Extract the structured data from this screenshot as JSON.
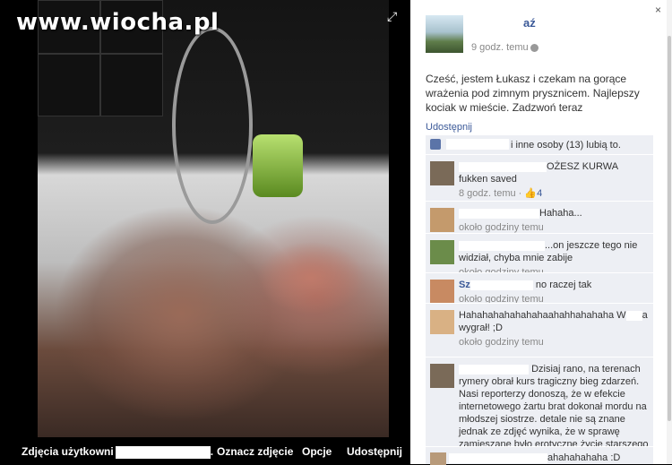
{
  "watermark": "www.wiocha.pl",
  "bottom_bar": {
    "album": "Zdjęcia użytkowni",
    "album_tail": ".",
    "tag": "Oznacz zdjęcie",
    "options": "Opcje",
    "share": "Udostępnij"
  },
  "post": {
    "author_suffix": "aź",
    "time": "9 godz. temu",
    "text": "Cześć, jestem Łukasz i czekam na gorące wrażenia pod zimnym prysznicem. Najlepszy kociak w mieście. Zadzwoń teraz",
    "share": "Udostępnij",
    "likes": "i inne osoby (13) lubią to."
  },
  "comments": [
    {
      "line1": "OŻESZ KURWA",
      "line2": "fukken saved",
      "time": "8 godz. temu",
      "likes": "4",
      "avatar_color": "#7a6a58"
    },
    {
      "line1": "Hahaha...",
      "time": "około godziny temu",
      "avatar_color": "#c49a6c"
    },
    {
      "line1": "...on jeszcze tego nie widział, chyba mnie zabije",
      "time": "około godziny temu",
      "avatar_color": "#6b8c4a"
    },
    {
      "name_prefix": "Sz",
      "line1": "no raczej tak",
      "time": "około godziny temu",
      "avatar_color": "#c88a62"
    },
    {
      "line1": "Hahahahahahahahaahahhahahaha W",
      "line1b": "a wygrał! ;D",
      "time": "około godziny temu",
      "avatar_color": "#d9b184"
    },
    {
      "line1": "Dzisiaj rano, na terenach rymery obrał kurs tragiczny bieg zdarzeń. Nasi reporterzy donoszą, że w efekcie internetowego żartu brat dokonał mordu na młodszej siostrze. detale nie są znane jednak ze zdjęć wynika, że w sprawę zamieszane było erotyczne życie starszego z rodzeństwa~!",
      "time": "",
      "avatar_color": "#7a6a58"
    },
    {
      "line1": "ahahahahaha :D",
      "time": "",
      "avatar_color": "#b89a7a"
    }
  ],
  "icons": {
    "close": "×",
    "fullscreen": "⤢"
  }
}
